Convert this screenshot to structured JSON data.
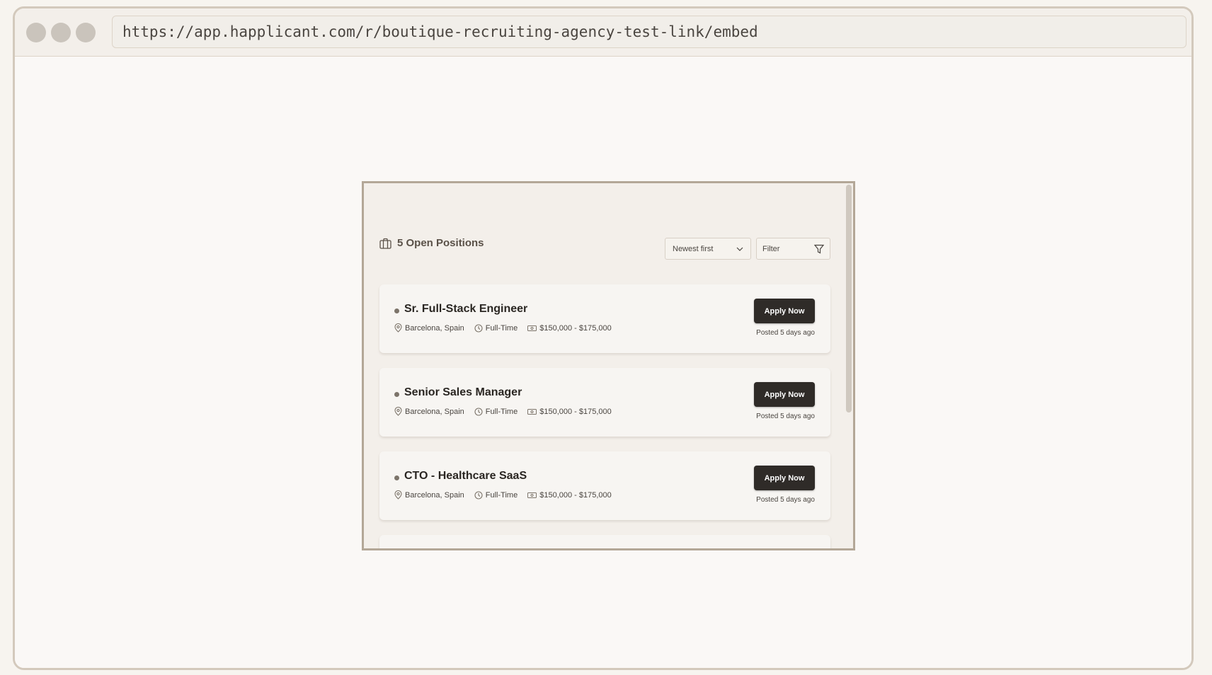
{
  "browser": {
    "url": "https://app.happlicant.com/r/boutique-recruiting-agency-test-link/embed"
  },
  "careers": {
    "title": "5 Open Positions",
    "sort_label": "Newest first",
    "filter_label": "Filter",
    "jobs": [
      {
        "title": "Sr. Full-Stack Engineer",
        "location": "Barcelona, Spain",
        "type": "Full-Time",
        "salary": "$150,000 - $175,000",
        "apply_label": "Apply Now",
        "posted": "Posted 5 days ago"
      },
      {
        "title": "Senior Sales Manager",
        "location": "Barcelona, Spain",
        "type": "Full-Time",
        "salary": "$150,000 - $175,000",
        "apply_label": "Apply Now",
        "posted": "Posted 5 days ago"
      },
      {
        "title": "CTO - Healthcare SaaS",
        "location": "Barcelona, Spain",
        "type": "Full-Time",
        "salary": "$150,000 - $175,000",
        "apply_label": "Apply Now",
        "posted": "Posted 5 days ago"
      }
    ]
  }
}
